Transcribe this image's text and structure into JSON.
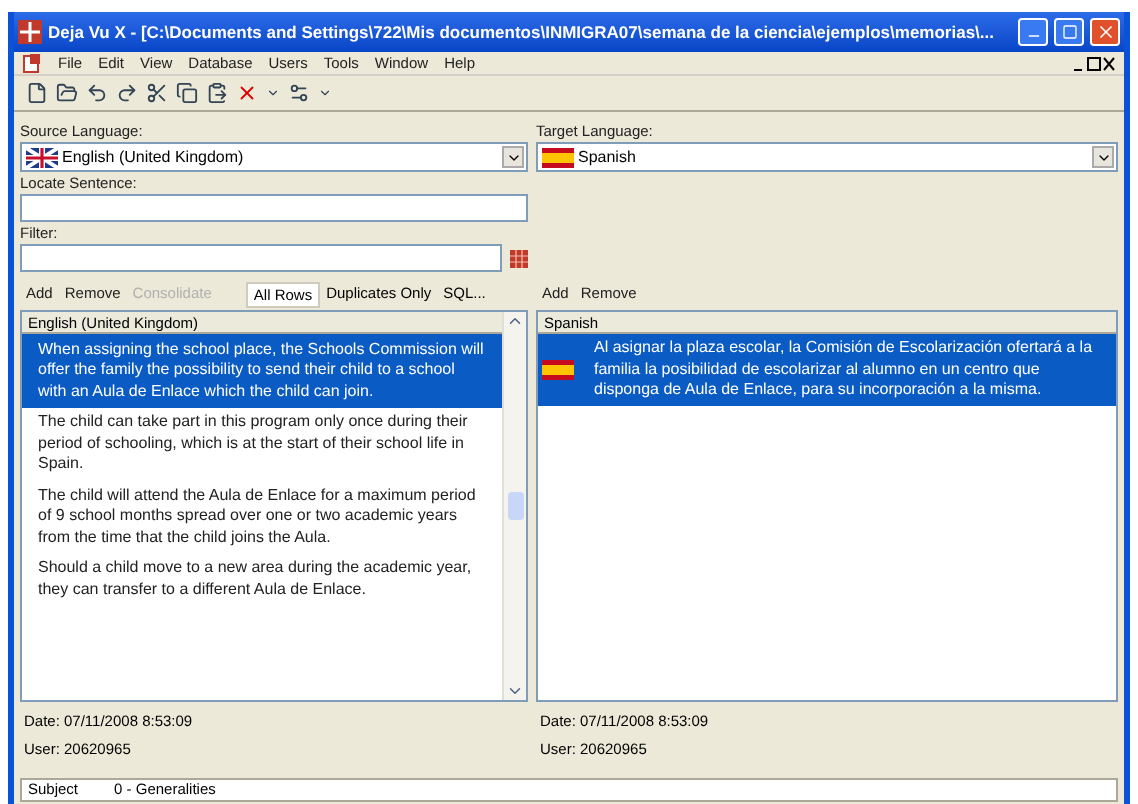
{
  "window": {
    "title": "Deja Vu X - [C:\\Documents and Settings\\722\\Mis documentos\\INMIGRA07\\semana de la ciencia\\ejemplos\\memorias\\..."
  },
  "menu": [
    "File",
    "Edit",
    "View",
    "Database",
    "Users",
    "Tools",
    "Window",
    "Help"
  ],
  "source_language": {
    "label": "Source Language:",
    "value": "English (United Kingdom)"
  },
  "target_language": {
    "label": "Target Language:",
    "value": "Spanish"
  },
  "locate_sentence": {
    "label": "Locate Sentence:"
  },
  "filter": {
    "label": "Filter:"
  },
  "left_actions": [
    {
      "label": "Add",
      "disabled": false
    },
    {
      "label": "Remove",
      "disabled": false
    },
    {
      "label": "Consolidate",
      "disabled": true
    }
  ],
  "view_filters": [
    {
      "label": "All Rows",
      "selected": true
    },
    {
      "label": "Duplicates Only",
      "selected": false
    },
    {
      "label": "SQL...",
      "selected": false
    }
  ],
  "right_actions": [
    {
      "label": "Add",
      "disabled": false
    },
    {
      "label": "Remove",
      "disabled": false
    }
  ],
  "source_list": {
    "header": "English (United Kingdom)",
    "rows": [
      {
        "text": "When assigning the school place, the Schools Commission will offer the family the possibility to send their child to a school with an Aula de Enlace which the child can join.",
        "selected": true
      },
      {
        "text": "The child can take part in this program only once during their period of schooling, which is at the start of their school life in Spain.",
        "selected": false
      },
      {
        "text": "The child will attend the Aula de Enlace for a maximum period of 9 school months spread over one or two academic years from the time that the child joins the Aula.",
        "selected": false
      },
      {
        "text": "Should a child move to a new area during the academic year, they can transfer to a different Aula de Enlace.",
        "selected": false
      }
    ]
  },
  "target_list": {
    "header": "Spanish",
    "rows": [
      {
        "text": "Al asignar la plaza escolar, la Comisión de Escolarización ofertará a la familia la posibilidad de escolarizar al alumno en un centro que disponga de Aula de Enlace, para su incorporación a la misma.",
        "selected": true
      }
    ]
  },
  "source_info": {
    "date": "Date:  07/11/2008 8:53:09",
    "user": "User:  20620965"
  },
  "target_info": {
    "date": "Date:  07/11/2008 8:53:09",
    "user": "User:  20620965"
  },
  "subject": {
    "label": "Subject",
    "value": "0 - Generalities"
  }
}
